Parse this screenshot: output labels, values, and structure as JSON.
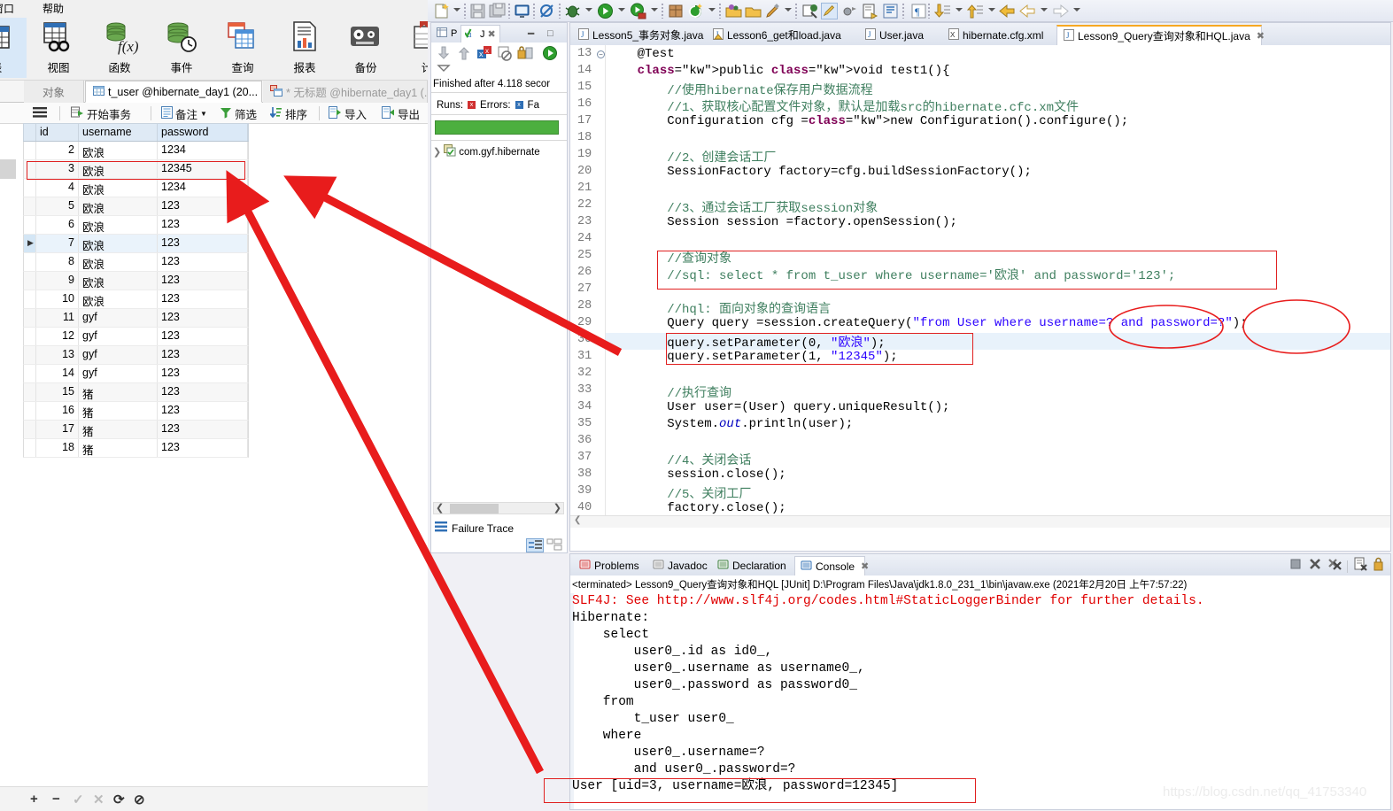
{
  "navicat": {
    "menubar": [
      {
        "label": "窗口"
      },
      {
        "label": "帮助"
      }
    ],
    "toolbar": [
      {
        "label": "表",
        "icon": "table-icon",
        "selected": true
      },
      {
        "label": "视图",
        "icon": "view-icon",
        "selected": false
      },
      {
        "label": "函数",
        "icon": "function-icon",
        "selected": false
      },
      {
        "label": "事件",
        "icon": "event-icon",
        "selected": false
      },
      {
        "label": "查询",
        "icon": "query-icon",
        "selected": false
      },
      {
        "label": "报表",
        "icon": "report-icon",
        "selected": false
      },
      {
        "label": "备份",
        "icon": "backup-icon",
        "selected": false
      },
      {
        "label": "计",
        "icon": "schedule-icon",
        "selected": false
      }
    ],
    "tabs": [
      {
        "label": "对象",
        "state": "plain"
      },
      {
        "label": "t_user @hibernate_day1 (20...",
        "state": "active",
        "icon": "table-icon"
      },
      {
        "label": "* 无标题 @hibernate_day1 (..",
        "state": "inactive",
        "icon": "query-icon"
      }
    ],
    "grid_toolbar": [
      {
        "label": "",
        "icon": "hamburger-icon"
      },
      {
        "label": "开始事务",
        "icon": "begin-transaction-icon"
      },
      {
        "label": "备注",
        "icon": "note-icon",
        "caret": true
      },
      {
        "label": "筛选",
        "icon": "filter-icon"
      },
      {
        "label": "排序",
        "icon": "sort-icon"
      },
      {
        "label": "导入",
        "icon": "import-icon"
      },
      {
        "label": "导出",
        "icon": "export-icon"
      }
    ],
    "grid": {
      "columns": [
        "id",
        "username",
        "password"
      ],
      "rows": [
        {
          "id": "2",
          "username": "欧浪",
          "password": "1234"
        },
        {
          "id": "3",
          "username": "欧浪",
          "password": "12345"
        },
        {
          "id": "4",
          "username": "欧浪",
          "password": "1234"
        },
        {
          "id": "5",
          "username": "欧浪",
          "password": "123"
        },
        {
          "id": "6",
          "username": "欧浪",
          "password": "123"
        },
        {
          "id": "7",
          "username": "欧浪",
          "password": "123"
        },
        {
          "id": "8",
          "username": "欧浪",
          "password": "123"
        },
        {
          "id": "9",
          "username": "欧浪",
          "password": "123"
        },
        {
          "id": "10",
          "username": "欧浪",
          "password": "123"
        },
        {
          "id": "11",
          "username": "gyf",
          "password": "123"
        },
        {
          "id": "12",
          "username": "gyf",
          "password": "123"
        },
        {
          "id": "13",
          "username": "gyf",
          "password": "123"
        },
        {
          "id": "14",
          "username": "gyf",
          "password": "123"
        },
        {
          "id": "15",
          "username": "猪",
          "password": "123"
        },
        {
          "id": "16",
          "username": "猪",
          "password": "123"
        },
        {
          "id": "17",
          "username": "猪",
          "password": "123"
        },
        {
          "id": "18",
          "username": "猪",
          "password": "123"
        }
      ],
      "highlighted_row_index": 1,
      "current_row_index": 5
    },
    "bottom_buttons": [
      {
        "icon": "plus-icon",
        "label": "+",
        "enabled": true
      },
      {
        "icon": "minus-icon",
        "label": "−",
        "enabled": true
      },
      {
        "icon": "check-icon",
        "label": "✓",
        "enabled": false
      },
      {
        "icon": "cross-icon",
        "label": "✕",
        "enabled": false
      },
      {
        "icon": "refresh-icon",
        "label": "⟳",
        "enabled": true
      },
      {
        "icon": "stop-icon",
        "label": "⊘",
        "enabled": true
      }
    ]
  },
  "eclipse": {
    "junit": {
      "tabs": [
        {
          "label": "P",
          "icon": "package-explorer-icon",
          "active": false
        },
        {
          "label": "J",
          "icon": "junit-icon",
          "active": true
        },
        {
          "label": "",
          "icon": "close-icon",
          "active": false
        }
      ],
      "window_buttons": [
        "minimize-icon",
        "maximize-icon"
      ],
      "view_toolbar": [
        "next-failure-icon",
        "prev-failure-icon",
        "show-failures-icon",
        "show-errors-icon",
        "stop-icon",
        "lock-icon",
        "rerun-icon",
        "view-menu-icon"
      ],
      "status": "Finished after 4.118 secor",
      "counts": {
        "runs_label": "Runs:",
        "errors_label": "Errors:",
        "failures_label": "Fa"
      },
      "progress_color": "#4caf3f",
      "tree": [
        {
          "label": "com.gyf.hibernate",
          "icon": "test-suite-icon"
        }
      ],
      "failure_trace_label": "Failure Trace"
    },
    "editor_tabs": [
      {
        "label": "Lesson5_事务对象.java",
        "icon": "java-file-icon",
        "active": false
      },
      {
        "label": "Lesson6_get和load.java",
        "icon": "java-file-warn-icon",
        "active": false
      },
      {
        "label": "User.java",
        "icon": "java-file-icon",
        "active": false
      },
      {
        "label": "hibernate.cfg.xml",
        "icon": "xml-file-icon",
        "active": false
      },
      {
        "label": "Lesson9_Query查询对象和HQL.java",
        "icon": "java-file-icon",
        "active": true,
        "close": true
      }
    ],
    "code": {
      "first_line": 13,
      "highlighted_line": 30,
      "lines": [
        {
          "n": 13,
          "fold": true,
          "text": "    @Test"
        },
        {
          "n": 14,
          "fold": false,
          "text": "    public void test1(){"
        },
        {
          "n": 15,
          "fold": false,
          "text": "        //使用hibernate保存用户数据流程"
        },
        {
          "n": 16,
          "fold": false,
          "text": "        //1、获取核心配置文件对象，默认是加载src的hibernate.cfc.xm文件"
        },
        {
          "n": 17,
          "fold": false,
          "text": "        Configuration cfg =new Configuration().configure();"
        },
        {
          "n": 18,
          "fold": false,
          "text": ""
        },
        {
          "n": 19,
          "fold": false,
          "text": "        //2、创建会话工厂"
        },
        {
          "n": 20,
          "fold": false,
          "text": "        SessionFactory factory=cfg.buildSessionFactory();"
        },
        {
          "n": 21,
          "fold": false,
          "text": ""
        },
        {
          "n": 22,
          "fold": false,
          "text": "        //3、通过会话工厂获取session对象"
        },
        {
          "n": 23,
          "fold": false,
          "text": "        Session session =factory.openSession();"
        },
        {
          "n": 24,
          "fold": false,
          "text": ""
        },
        {
          "n": 25,
          "fold": false,
          "text": "        //查询对象"
        },
        {
          "n": 26,
          "fold": false,
          "text": "        //sql: select * from t_user where username='欧浪' and password='123';"
        },
        {
          "n": 27,
          "fold": false,
          "text": ""
        },
        {
          "n": 28,
          "fold": false,
          "text": "        //hql: 面向对象的查询语言"
        },
        {
          "n": 29,
          "fold": false,
          "text": "        Query query =session.createQuery(\"from User where username=? and password=?\");"
        },
        {
          "n": 30,
          "fold": false,
          "text": "        query.setParameter(0, \"欧浪\");"
        },
        {
          "n": 31,
          "fold": false,
          "text": "        query.setParameter(1, \"12345\");"
        },
        {
          "n": 32,
          "fold": false,
          "text": ""
        },
        {
          "n": 33,
          "fold": false,
          "text": "        //执行查询"
        },
        {
          "n": 34,
          "fold": false,
          "text": "        User user=(User) query.uniqueResult();"
        },
        {
          "n": 35,
          "fold": false,
          "text": "        System.out.println(user);"
        },
        {
          "n": 36,
          "fold": false,
          "text": ""
        },
        {
          "n": 37,
          "fold": false,
          "text": "        //4、关闭会话"
        },
        {
          "n": 38,
          "fold": false,
          "text": "        session.close();"
        },
        {
          "n": 39,
          "fold": false,
          "text": "        //5、关闭工厂"
        },
        {
          "n": 40,
          "fold": false,
          "text": "        factory.close();"
        },
        {
          "n": 41,
          "fold": false,
          "text": ""
        }
      ]
    },
    "console": {
      "tabs": [
        {
          "label": "Problems",
          "icon": "problems-icon",
          "active": false
        },
        {
          "label": "Javadoc",
          "icon": "javadoc-icon",
          "active": false
        },
        {
          "label": "Declaration",
          "icon": "declaration-icon",
          "active": false
        },
        {
          "label": "Console",
          "icon": "console-icon",
          "active": true,
          "close": true
        }
      ],
      "toolbar": [
        "terminate-icon",
        "remove-launch-icon",
        "remove-all-icon",
        "clear-console-icon",
        "scroll-lock-icon"
      ],
      "header": "<terminated> Lesson9_Query查询对象和HQL [JUnit] D:\\Program Files\\Java\\jdk1.8.0_231_1\\bin\\javaw.exe (2021年2月20日 上午7:57:22)",
      "lines": [
        {
          "text": "SLF4J: See http://www.slf4j.org/codes.html#StaticLoggerBinder for further details.",
          "color": "#e00000"
        },
        {
          "text": "Hibernate: ",
          "color": "#000000"
        },
        {
          "text": "    select",
          "color": "#000000"
        },
        {
          "text": "        user0_.id as id0_,",
          "color": "#000000"
        },
        {
          "text": "        user0_.username as username0_,",
          "color": "#000000"
        },
        {
          "text": "        user0_.password as password0_",
          "color": "#000000"
        },
        {
          "text": "    from",
          "color": "#000000"
        },
        {
          "text": "        t_user user0_",
          "color": "#000000"
        },
        {
          "text": "    where",
          "color": "#000000"
        },
        {
          "text": "        user0_.username=?",
          "color": "#000000"
        },
        {
          "text": "        and user0_.password=?",
          "color": "#000000"
        },
        {
          "text": "User [uid=3, username=欧浪, password=12345]",
          "color": "#000000"
        }
      ]
    }
  },
  "annotations": {
    "accent_color": "#e81c1c",
    "boxes": [
      {
        "name": "grid-row-3-box"
      },
      {
        "name": "hql-sql-comment-box"
      },
      {
        "name": "set-parameter-box"
      },
      {
        "name": "console-result-box"
      }
    ],
    "ellipses": [
      {
        "name": "username-param-ellipse"
      },
      {
        "name": "password-param-ellipse"
      }
    ],
    "arrows": [
      {
        "name": "arrow-to-grid-row"
      },
      {
        "name": "arrow-to-setparameter"
      }
    ]
  },
  "watermark": "https://blog.csdn.net/qq_41753340"
}
